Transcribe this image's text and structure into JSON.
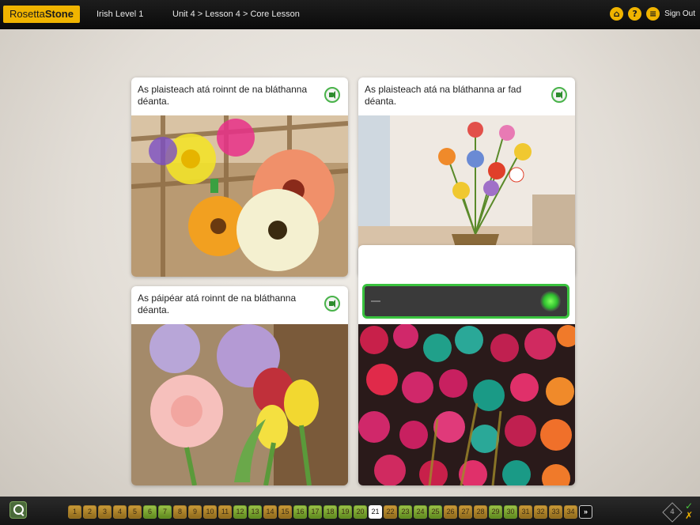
{
  "app": {
    "logo_part1": "Rosetta",
    "logo_part2": "Stone",
    "course": "Irish Level 1",
    "breadcrumb": "Unit 4 > Lesson 4 > Core Lesson",
    "sign_out": "Sign Out",
    "icons": [
      "home-icon",
      "help-icon",
      "menu-icon"
    ]
  },
  "cards": [
    {
      "caption": "As plaisteach atá roinnt de na bláthanna déanta.",
      "image": "plastic-and-real-flowers"
    },
    {
      "caption": "As plaisteach atá na bláthanna ar fad déanta.",
      "image": "plastic-flowers-in-vase"
    },
    {
      "caption": "As páipéar atá roinnt de na bláthanna déanta.",
      "image": "paper-roses-and-tulips"
    },
    {
      "caption": "",
      "image": "paper-ribbon-flowers"
    }
  ],
  "answer": {
    "placeholder": "—"
  },
  "progress": {
    "current": "21",
    "pages": [
      "1",
      "2",
      "3",
      "4",
      "5",
      "6",
      "7",
      "8",
      "9",
      "10",
      "11",
      "12",
      "13",
      "14",
      "15",
      "16",
      "17",
      "18",
      "19",
      "20",
      "21",
      "22",
      "23",
      "24",
      "25",
      "26",
      "27",
      "28",
      "29",
      "30",
      "31",
      "32",
      "33",
      "34"
    ],
    "next_label": "»",
    "counter": "4"
  },
  "colors": {
    "accent": "#f0b400",
    "correct": "#39c23e"
  }
}
